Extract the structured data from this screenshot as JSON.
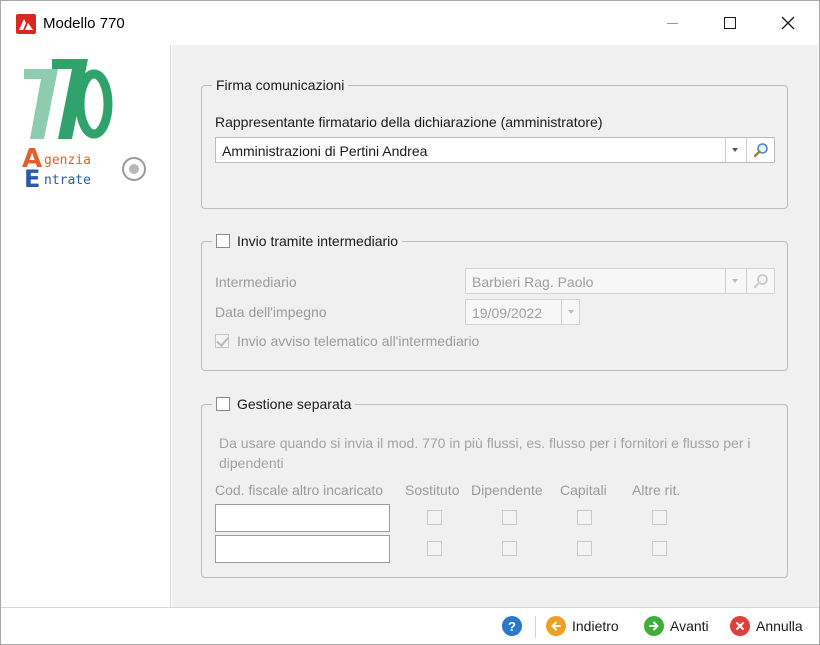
{
  "window": {
    "title": "Modello 770"
  },
  "sidebar": {
    "logo_number": "770",
    "logo_agency_line1": "genzia",
    "logo_agency_line2": "ntrate",
    "logo_letters": [
      "A",
      "E"
    ]
  },
  "firma": {
    "legend": "Firma comunicazioni",
    "rappresentante_label": "Rappresentante firmatario della dichiarazione (amministratore)",
    "rappresentante_value": "Amministrazioni di Pertini Andrea"
  },
  "intermediario": {
    "legend": "Invio tramite intermediario",
    "checked": false,
    "intermediario_label": "Intermediario",
    "intermediario_value": "Barbieri Rag. Paolo",
    "data_label": "Data dell'impegno",
    "data_value": "19/09/2022",
    "avviso_label": "Invio avviso telematico all'intermediario",
    "avviso_checked": true
  },
  "gestione": {
    "legend": "Gestione separata",
    "checked": false,
    "note": "Da usare quando si invia il mod. 770 in più flussi, es. flusso per i fornitori e flusso per i dipendenti",
    "columns": [
      "Cod. fiscale altro incaricato",
      "Sostituto",
      "Dipendente",
      "Capitali",
      "Altre rit."
    ],
    "rows": [
      {
        "cod_fiscale": "",
        "sostituto": false,
        "dipendente": false,
        "capitali": false,
        "altre": false
      },
      {
        "cod_fiscale": "",
        "sostituto": false,
        "dipendente": false,
        "capitali": false,
        "altre": false
      }
    ]
  },
  "footer": {
    "back_label": "Indietro",
    "next_label": "Avanti",
    "cancel_label": "Annulla"
  },
  "colors": {
    "accent_red": "#d8281f",
    "logo_green": "#2fa36b",
    "help_blue": "#2a78c8",
    "back_orange": "#f0a020",
    "next_green": "#3fae3a",
    "cancel_red": "#e0403a"
  }
}
